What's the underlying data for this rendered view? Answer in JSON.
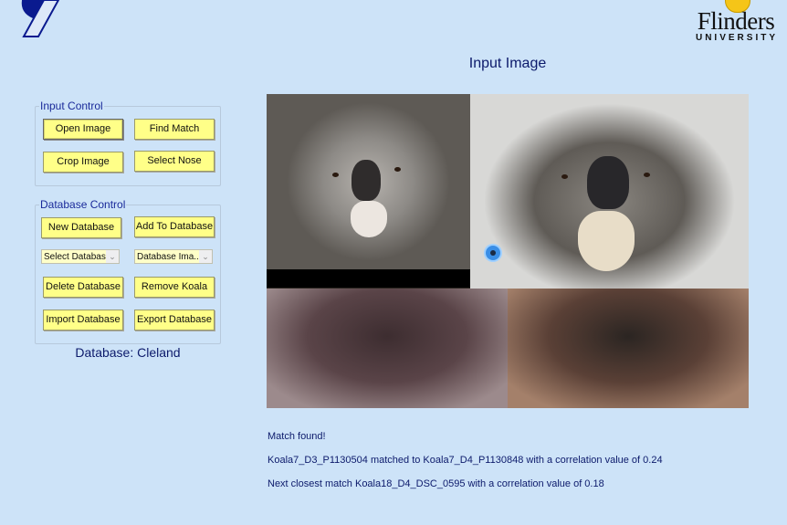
{
  "header": {
    "logo_left": "institution-logo",
    "logo_right_name": "Flinders",
    "logo_right_sub": "UNIVERSITY"
  },
  "input_control": {
    "group_label": "Input Control",
    "buttons": {
      "open_image": "Open Image",
      "find_match": "Find Match",
      "crop_image": "Crop Image",
      "select_nose": "Select Nose"
    }
  },
  "database_control": {
    "group_label": "Database Control",
    "buttons": {
      "new_database": "New Database",
      "add_to_database": "Add To Database",
      "delete_database": "Delete Database",
      "remove_koala": "Remove Koala",
      "import_database": "Import Database",
      "export_database": "Export Database"
    },
    "selects": {
      "select_database": "Select Database",
      "database_images": "Database Ima..."
    },
    "current_database_label": "Database: Cleland"
  },
  "image_panel": {
    "title": "Input Image",
    "images": [
      "koala-input-face",
      "koala-match-face",
      "koala-input-nose",
      "koala-match-nose"
    ]
  },
  "results": {
    "status": "Match found!",
    "match_line": "Koala7_D3_P1130504 matched to Koala7_D4_P1130848 with a correlation value of 0.24",
    "next_line": "Next closest match Koala18_D4_DSC_0595 with a correlation value of 0.18"
  },
  "colors": {
    "background": "#cde3f8",
    "button": "#ffff88",
    "text": "#0c1a6b"
  }
}
